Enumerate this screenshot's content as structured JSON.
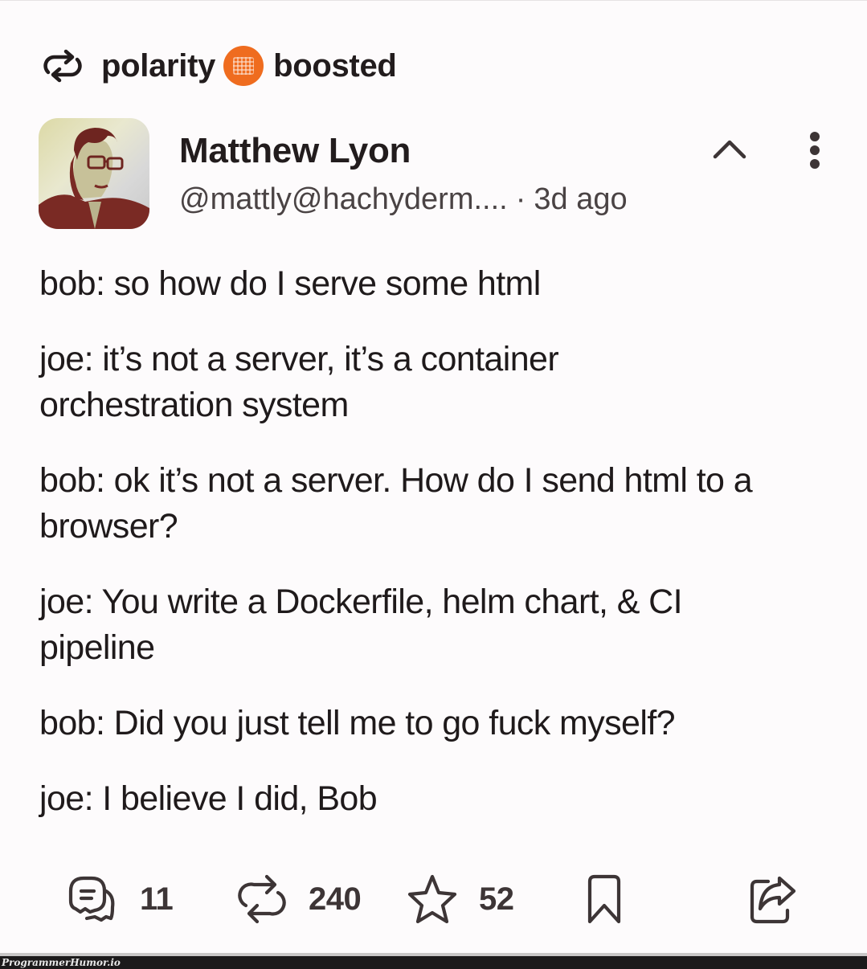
{
  "boost_header": {
    "icon": "boost-icon",
    "booster_name": "polarity",
    "instance_avatar": "instance-avatar",
    "label": "boosted"
  },
  "post": {
    "author": {
      "display_name": "Matthew Lyon",
      "handle": "@mattly@hachyderm....",
      "separator": "·",
      "timestamp": "3d ago"
    },
    "header_actions": {
      "collapse_icon": "chevron-up-icon",
      "more_icon": "more-vertical-icon"
    },
    "paragraphs": [
      "bob: so how do I serve some html",
      "joe: it’s not a server, it’s a container orchestration system",
      "bob: ok it’s not a server. How do I send html to a browser?",
      "joe: You write a Dockerfile, helm chart, & CI pipeline",
      "bob: Did you just tell me to go fuck myself?",
      "joe: I believe I did, Bob"
    ],
    "actions": {
      "replies": {
        "icon": "reply-icon",
        "count": "11"
      },
      "boosts": {
        "icon": "boost-icon",
        "count": "240"
      },
      "favourites": {
        "icon": "star-icon",
        "count": "52"
      },
      "bookmark": {
        "icon": "bookmark-icon"
      },
      "share": {
        "icon": "share-icon"
      }
    }
  },
  "watermark": {
    "text": "ProgrammerHumor.io"
  },
  "colors": {
    "background": "#fdfbfc",
    "text": "#1f1a1b",
    "icon": "#3d3536",
    "instance_accent": "#ef6c1f",
    "watermark_bar": "#1c1a1b"
  }
}
